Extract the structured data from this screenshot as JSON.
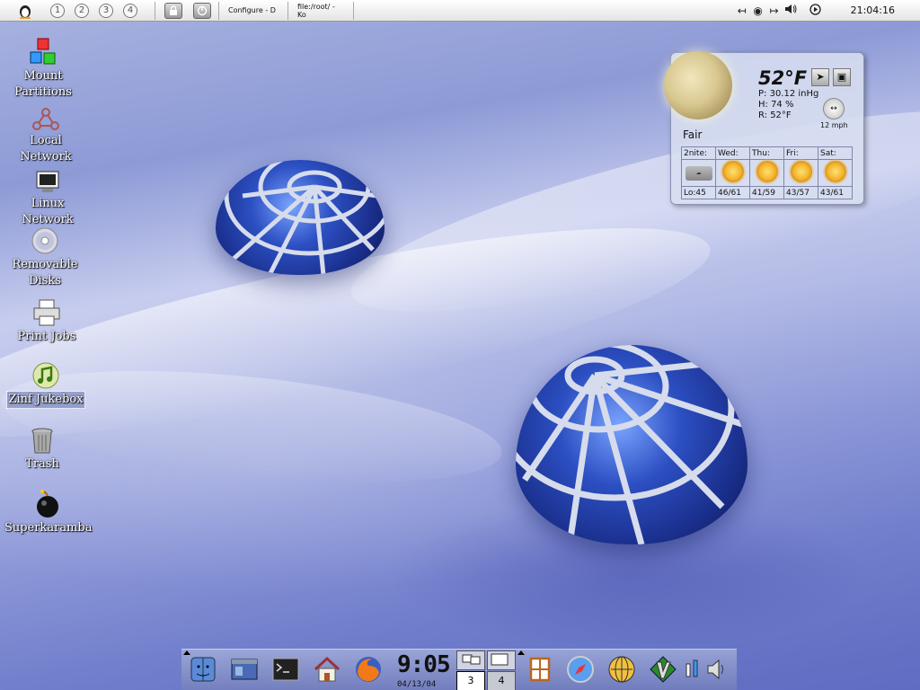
{
  "top_panel": {
    "desktops": [
      "1",
      "2",
      "3",
      "4"
    ],
    "tasks": [
      "Configure - D",
      "file:/root/ - Ko"
    ],
    "clock": "21:04:16"
  },
  "desktop_icons": [
    {
      "label": "Mount\nPartitions",
      "icon": "mount-partitions-icon"
    },
    {
      "label": "Local Network",
      "icon": "local-network-icon"
    },
    {
      "label": "Linux Network",
      "icon": "linux-network-icon"
    },
    {
      "label": "Removable\nDisks",
      "icon": "removable-disks-icon"
    },
    {
      "label": "Print Jobs",
      "icon": "printer-icon"
    },
    {
      "label": "Zinf Jukebox",
      "icon": "jukebox-icon"
    },
    {
      "label": "Trash",
      "icon": "trash-icon"
    },
    {
      "label": "Superkaramba",
      "icon": "bomb-icon"
    }
  ],
  "weather": {
    "temp": "52°F",
    "pressure": "P:  30.12 inHg",
    "humidity": "H:  74 %",
    "realfeel": "R:  52°F",
    "wind": "12 mph",
    "condition": "Fair",
    "forecast": [
      {
        "day": "2nite:",
        "temps": "Lo:45"
      },
      {
        "day": "Wed:",
        "temps": "46/61"
      },
      {
        "day": "Thu:",
        "temps": "41/59"
      },
      {
        "day": "Fri:",
        "temps": "43/57"
      },
      {
        "day": "Sat:",
        "temps": "43/61"
      }
    ]
  },
  "dock": {
    "clock": "9:05",
    "date": "04/13/04",
    "pager": [
      "3",
      "4"
    ]
  }
}
